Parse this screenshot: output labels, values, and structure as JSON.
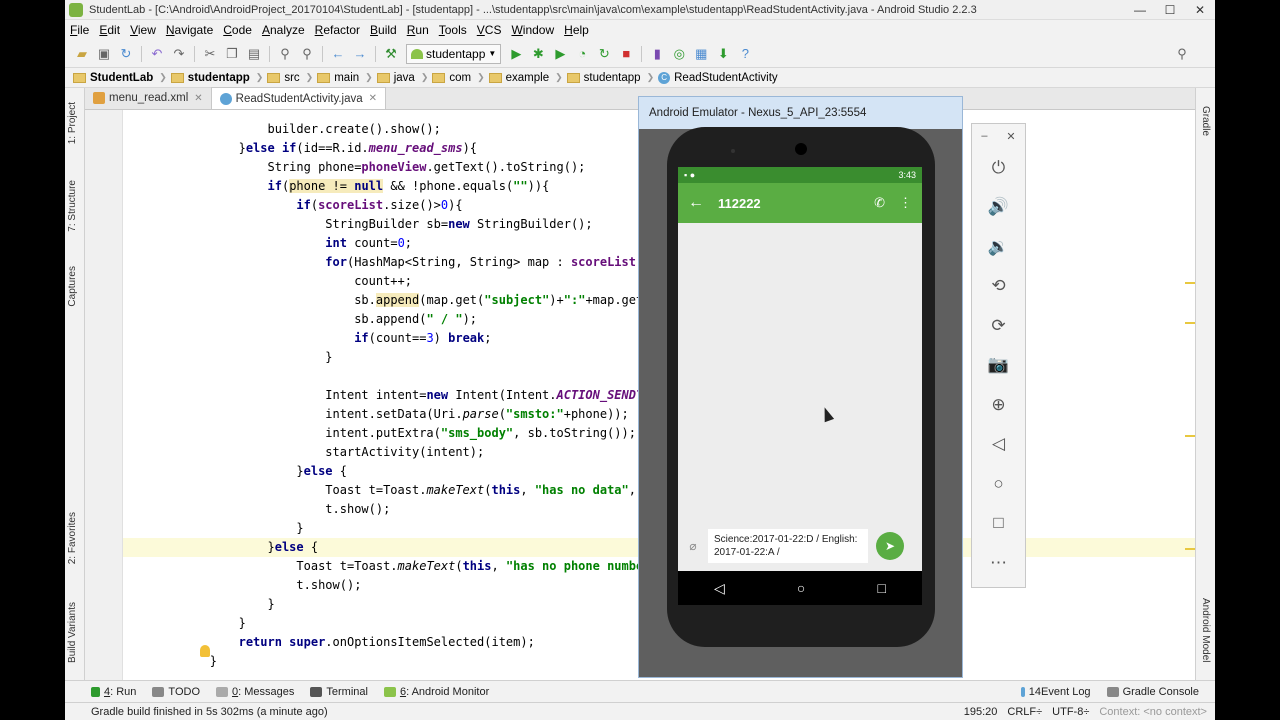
{
  "window": {
    "title": "StudentLab - [C:\\Android\\AndroidProject_20170104\\StudentLab] - [studentapp] - ...\\studentapp\\src\\main\\java\\com\\example\\studentapp\\ReadStudentActivity.java - Android Studio 2.2.3",
    "minimize": "—",
    "maximize": "☐",
    "close": "✕"
  },
  "menu": [
    "File",
    "Edit",
    "View",
    "Navigate",
    "Code",
    "Analyze",
    "Refactor",
    "Build",
    "Run",
    "Tools",
    "VCS",
    "Window",
    "Help"
  ],
  "toolbar": {
    "run_config": "studentapp"
  },
  "breadcrumbs": [
    "StudentLab",
    "studentapp",
    "src",
    "main",
    "java",
    "com",
    "example",
    "studentapp",
    "ReadStudentActivity"
  ],
  "tabs": [
    {
      "label": "menu_read.xml",
      "active": false
    },
    {
      "label": "ReadStudentActivity.java",
      "active": true
    }
  ],
  "left_tools": [
    "1: Project",
    "7: Structure",
    "Captures",
    "2: Favorites",
    "Build Variants"
  ],
  "right_tools": [
    "Gradle",
    "Android Model"
  ],
  "bottom_tools": [
    {
      "num": "4",
      "label": ": Run"
    },
    {
      "num": "",
      "label": "TODO"
    },
    {
      "num": "0",
      "label": ": Messages"
    },
    {
      "num": "",
      "label": "Terminal"
    },
    {
      "num": "6",
      "label": ": Android Monitor"
    }
  ],
  "bottom_right_tools": [
    {
      "num": "14",
      "label": " Event Log"
    },
    {
      "num": "",
      "label": "Gradle Console"
    }
  ],
  "status": {
    "message": "Gradle build finished in 5s 302ms (a minute ago)",
    "position": "195:20",
    "line_sep": "CRLF÷",
    "encoding": "UTF-8÷",
    "context": "Context: <no context>"
  },
  "emulator": {
    "title": "Android Emulator - Nexus_5_API_23:5554",
    "time": "3:43",
    "contact": "112222",
    "compose_text": "Science:2017-01-22:D / English: 2017-01-22:A /"
  },
  "emulator_controls": [
    "power-icon",
    "volume-up-icon",
    "volume-down-icon",
    "rotate-left-icon",
    "rotate-right-icon",
    "camera-icon",
    "zoom-icon",
    "back-icon",
    "home-icon",
    "overview-icon",
    "more-icon"
  ]
}
